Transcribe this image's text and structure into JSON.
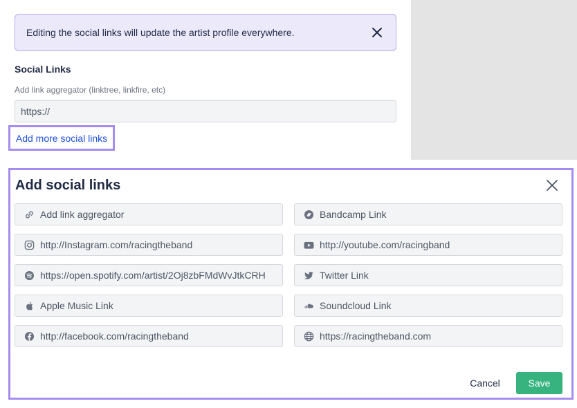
{
  "notice": {
    "text": "Editing the social links will update the artist profile everywhere.",
    "close_icon": "close-icon"
  },
  "social_links": {
    "title": "Social Links",
    "aggregator_label": "Add link aggregator (linktree, linkfire, etc)",
    "aggregator_placeholder": "https://",
    "add_more_label": "Add more social links"
  },
  "modal": {
    "title": "Add social links",
    "fields": [
      {
        "icon": "link-icon",
        "placeholder": "Add link aggregator",
        "value": ""
      },
      {
        "icon": "bandcamp-icon",
        "placeholder": "Bandcamp Link",
        "value": ""
      },
      {
        "icon": "instagram-icon",
        "placeholder": "",
        "value": "http://Instagram.com/racingtheband"
      },
      {
        "icon": "youtube-icon",
        "placeholder": "",
        "value": "http://youtube.com/racingband"
      },
      {
        "icon": "spotify-icon",
        "placeholder": "",
        "value": "https://open.spotify.com/artist/2Oj8zbFMdWvJtkCRH"
      },
      {
        "icon": "twitter-icon",
        "placeholder": "Twitter Link",
        "value": ""
      },
      {
        "icon": "apple-icon",
        "placeholder": "Apple Music Link",
        "value": ""
      },
      {
        "icon": "soundcloud-icon",
        "placeholder": "Soundcloud Link",
        "value": ""
      },
      {
        "icon": "facebook-icon",
        "placeholder": "",
        "value": "http://facebook.com/racingtheband"
      },
      {
        "icon": "globe-icon",
        "placeholder": "",
        "value": "https://racingtheband.com"
      }
    ],
    "cancel_label": "Cancel",
    "save_label": "Save"
  },
  "colors": {
    "accent": "#a58cf0",
    "notice_bg": "#ece9fb",
    "link": "#1d4ed8",
    "save": "#36b37e",
    "icon": "#6b7280"
  }
}
